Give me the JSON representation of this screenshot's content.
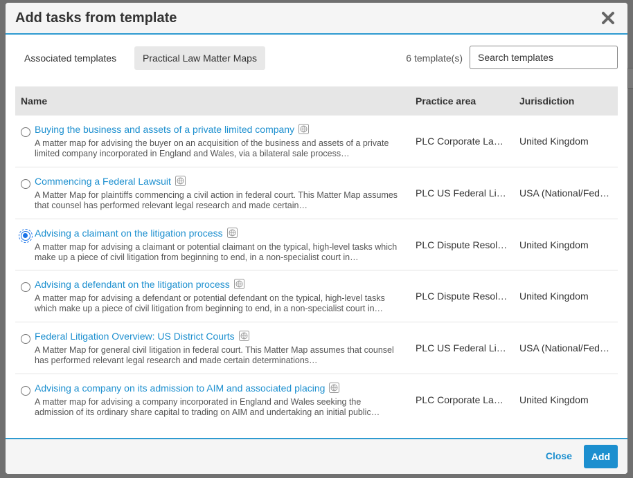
{
  "dialog": {
    "title": "Add tasks from template",
    "tabs": [
      {
        "label": "Associated templates",
        "active": false
      },
      {
        "label": "Practical Law Matter Maps",
        "active": true
      }
    ],
    "template_count": "6 template(s)",
    "search": {
      "placeholder": "Search templates",
      "value": ""
    },
    "table": {
      "headers": {
        "name": "Name",
        "practice_area": "Practice area",
        "jurisdiction": "Jurisdiction"
      },
      "rows": [
        {
          "title": "Buying the business and assets of a private limited company",
          "description": "A matter map for advising the buyer on an acquisition of the business and assets of a private limited company incorporated in England and Wales, via a bilateral sale process…",
          "practice_area": "PLC Corporate Law,…",
          "jurisdiction": "United Kingdom",
          "selected": false
        },
        {
          "title": "Commencing a Federal Lawsuit",
          "description": "A Matter Map for plaintiffs commencing a civil action in federal court. This Matter Map assumes that counsel has performed relevant legal research and made certain…",
          "practice_area": "PLC US Federal Liti…",
          "jurisdiction": "USA (National/Fede…",
          "selected": false
        },
        {
          "title": "Advising a claimant on the litigation process",
          "description": "A matter map for advising a claimant or potential claimant on the typical, high-level tasks which make up a piece of civil litigation from beginning to end, in a non-specialist court in…",
          "practice_area": "PLC Dispute Resolu…",
          "jurisdiction": "United Kingdom",
          "selected": true
        },
        {
          "title": "Advising a defendant on the litigation process",
          "description": "A matter map for advising a defendant or potential defendant on the typical, high-level tasks which make up a piece of civil litigation from beginning to end, in a non-specialist court in…",
          "practice_area": "PLC Dispute Resolu…",
          "jurisdiction": "United Kingdom",
          "selected": false
        },
        {
          "title": "Federal Litigation Overview: US District Courts",
          "description": "A Matter Map for general civil litigation in federal court. This Matter Map assumes that counsel has performed relevant legal research and made certain determinations…",
          "practice_area": "PLC US Federal Liti…",
          "jurisdiction": "USA (National/Fede…",
          "selected": false
        },
        {
          "title": "Advising a company on its admission to AIM and associated placing",
          "description": "A matter map for advising a company incorporated in England and Wales seeking the admission of its ordinary share capital to trading on AIM and undertaking an initial public…",
          "practice_area": "PLC Corporate Law,…",
          "jurisdiction": "United Kingdom",
          "selected": false
        }
      ]
    },
    "footer": {
      "close_label": "Close",
      "add_label": "Add"
    }
  },
  "colors": {
    "accent": "#1c8fcf",
    "divider": "#2e9ad0",
    "radio_selected": "#1a73e8"
  },
  "icons": {
    "close": "close-icon",
    "row_badge": "globe-icon"
  }
}
